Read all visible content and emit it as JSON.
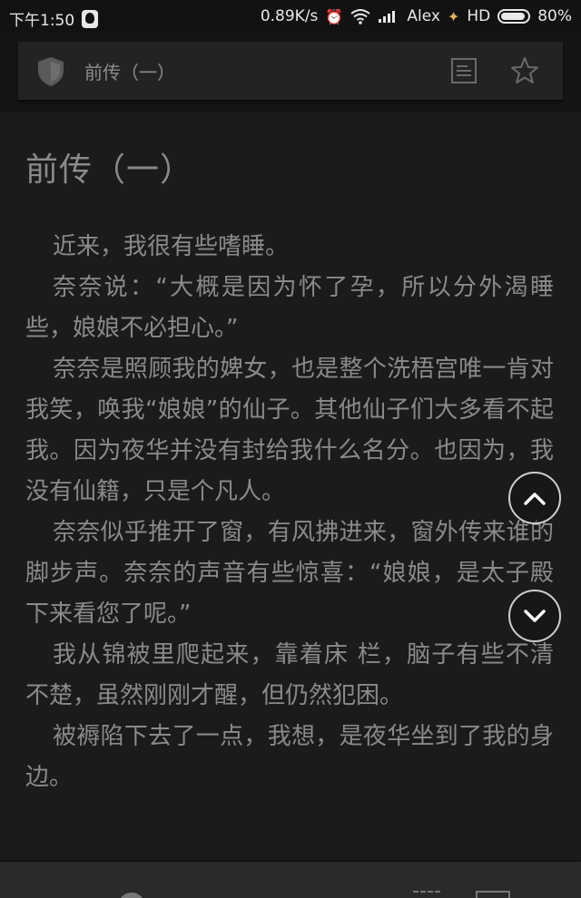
{
  "status_bar": {
    "time": "下午1:50",
    "network_speed": "0.89K/s",
    "carrier": "Alex",
    "network_type": "HD",
    "battery": "80%",
    "battery_level": 0.8
  },
  "toolbar": {
    "title": "前传（一）"
  },
  "chapter": {
    "title": "前传（一）",
    "paragraphs": [
      "近来，我很有些嗜睡。",
      "奈奈说：“大概是因为怀了孕，所以分外渴睡些，娘娘不必担心。”",
      "奈奈是照顾我的婢女，也是整个洗梧宫唯一肯对我笑，唤我“娘娘”的仙子。其他仙子们大多看不起我。因为夜华并没有封给我什么名分。也因为，我没有仙籍，只是个凡人。",
      "奈奈似乎推开了窗，有风拂进来，窗外传来谁的脚步声。奈奈的声音有些惊喜：“娘娘，是太子殿下来看您了呢。”",
      "我从锦被里爬起来，靠着床 栏，脑子有些不清不楚，虽然刚刚才醒，但仍然犯困。",
      "被褥陷下去了一点，我想，是夜华坐到了我的身边。"
    ]
  },
  "icons": {
    "toolbar": [
      "shield-icon",
      "document-icon",
      "star-icon"
    ],
    "nav": [
      "chevron-up-icon",
      "chevron-down-icon"
    ]
  }
}
